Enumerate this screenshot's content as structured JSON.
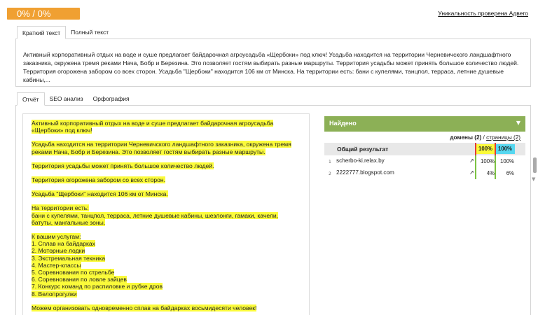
{
  "header": {
    "score": "0% / 0%",
    "unique_link": "Уникальность проверена Адвего"
  },
  "tabs_top": [
    {
      "label": "Краткий текст",
      "active": true
    },
    {
      "label": "Полный текст",
      "active": false
    }
  ],
  "source_text": "Активный корпоративный отдых на воде и суше предлагает байдарочная агроусадьба «Щербоки» под ключ! Усадьба находится на территории Черневичского ландшафтного заказника, окружена тремя реками Нача, Бобр и Березина. Это позволяет гостям выбирать разные маршруты. Территория усадьбы может принять большое количество людей. Территория огорожена забором со всех сторон. Усадьба \"Щербоки\" находится 106 км от Минска. На территории есть: бани с купелями, танцпол, терраса, летние душевые кабины,...",
  "tabs_bottom": [
    {
      "label": "Отчёт",
      "active": true
    },
    {
      "label": "SEO анализ",
      "active": false
    },
    {
      "label": "Орфография",
      "active": false
    }
  ],
  "result_paragraphs": [
    [
      "Активный корпоративный отдых на воде и суше предлагает байдарочная агроусадьба «Щербоки» под ключ!"
    ],
    [
      "Усадьба находится на территории Черневичского ландшафтного заказника, окружена тремя реками Нача, Бобр и Березина. Это позволяет гостям выбирать разные маршруты."
    ],
    [
      "Территория усадьбы может принять большое количество людей."
    ],
    [
      "Территория огорожена забором со всех сторон."
    ],
    [
      "Усадьба \"Щербоки\" находится 106 км от Минска."
    ],
    [
      "На территории есть:",
      "бани с купелями, танцпол, терраса, летние душевые кабины, шезлонги, гамаки, качели, батуты, мангальные зоны."
    ],
    [
      "К вашим услугам:",
      "1. Сплав на байдарках",
      "2. Моторные лодки",
      "3. Экстремальная техника",
      "4. Мастер-классы",
      "5. Соревнования по стрельбе",
      "6. Соревнования по ловле зайцев",
      "7. Конкурс команд по распиловке и рубке дров",
      "8. Велопрогулки"
    ],
    [
      "Можем организовать одновременно сплав на байдарках восьмидесяти человек!"
    ]
  ],
  "found_panel": {
    "title": "Найдено",
    "domains_label": "домены (2)",
    "separator": " / ",
    "pages_label": "страницы (2)",
    "header_label": "Общий результат",
    "header_col1": "100%",
    "header_col2": "100%",
    "rows": [
      {
        "index": "1",
        "domain": "scherbo-ki.relax.by",
        "col1": "100%",
        "col2": "100%"
      },
      {
        "index": "2",
        "domain": "2222777.blogspot.com",
        "col1": "4%",
        "col2": "6%"
      }
    ]
  },
  "colors": {
    "score_bg": "#f0a032",
    "highlight": "#fbfb3a",
    "found_bar": "#8cb056",
    "col1_accent": "#fbfb3a",
    "col2_accent": "#56d7f0",
    "red_line": "#e23a3a",
    "green_line": "#7cc242"
  }
}
